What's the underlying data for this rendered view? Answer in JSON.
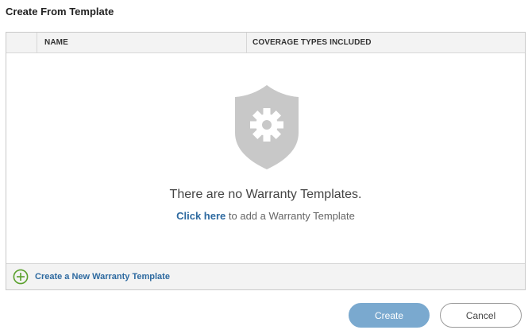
{
  "dialog": {
    "title": "Create From Template"
  },
  "table": {
    "columns": {
      "name": "NAME",
      "coverage": "COVERAGE TYPES INCLUDED"
    },
    "empty": {
      "message": "There are no Warranty Templates.",
      "link": "Click here",
      "hint_rest": " to add a Warranty Template",
      "icon": "shield-gear-icon"
    },
    "footer": {
      "create_new_label": "Create a New Warranty Template",
      "icon": "plus-circle-icon"
    }
  },
  "buttons": {
    "create": "Create",
    "cancel": "Cancel"
  },
  "colors": {
    "accent": "#2e6aa0",
    "primary_button": "#7aa9cf",
    "plus_icon": "#5aa02c",
    "empty_icon": "#c8c8c8"
  }
}
